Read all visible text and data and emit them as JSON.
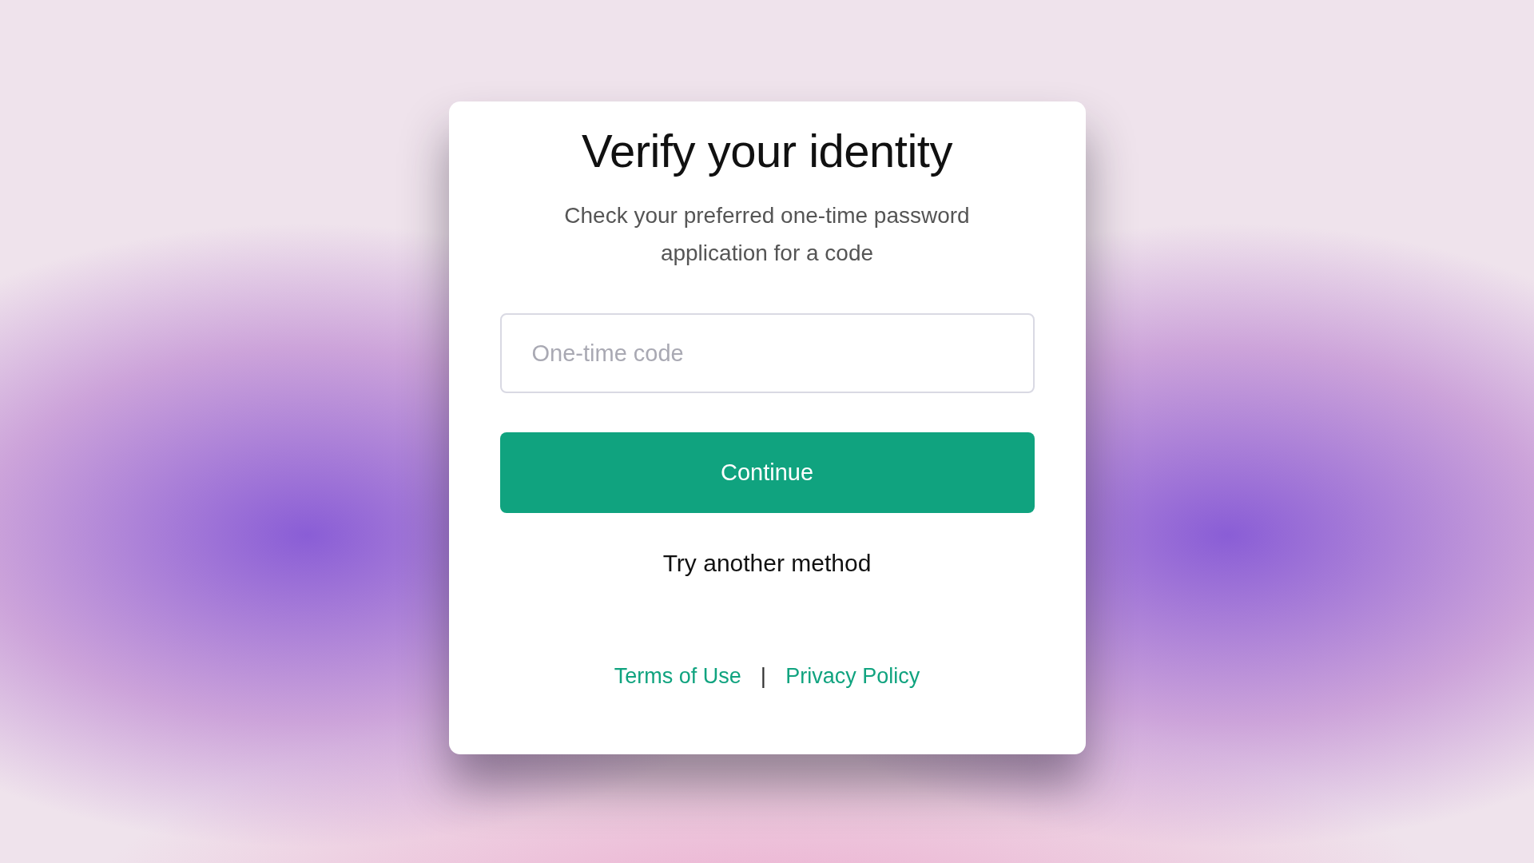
{
  "dialog": {
    "title": "Verify your identity",
    "subtitle": "Check your preferred one-time password application for a code",
    "code_field": {
      "placeholder": "One-time code"
    },
    "primary_button": "Continue",
    "secondary_link": "Try another method",
    "footer": {
      "links": [
        "Terms of Use",
        "Privacy Policy"
      ],
      "separator": "|"
    }
  }
}
